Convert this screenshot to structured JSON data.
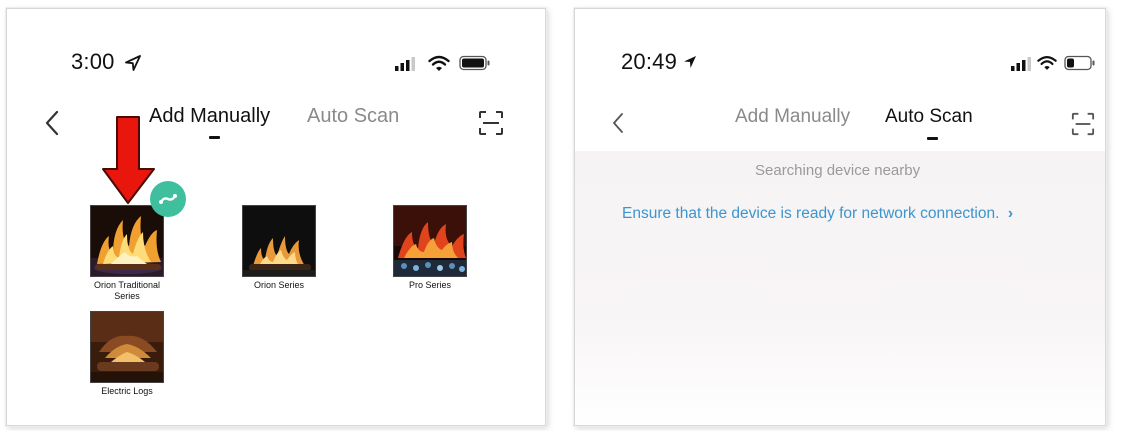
{
  "left_screen": {
    "status_time": "3:00",
    "tabs": {
      "add_manually": "Add Manually",
      "auto_scan": "Auto Scan"
    },
    "products": [
      {
        "label": "Orion Traditional Series",
        "label_line1": "Orion Traditional",
        "label_line2": "Series"
      },
      {
        "label": "Orion Series"
      },
      {
        "label": "Pro Series"
      },
      {
        "label": "Electric Logs"
      }
    ],
    "annotation_arrow_color": "#e8160c",
    "badge_color": "#3fbf9d"
  },
  "right_screen": {
    "status_time": "20:49",
    "tabs": {
      "add_manually": "Add Manually",
      "auto_scan": "Auto Scan"
    },
    "searching_text": "Searching device nearby",
    "ensure_text": "Ensure that the device is ready for network connection.",
    "ensure_chevron": "›",
    "link_color": "#3b95cf"
  }
}
